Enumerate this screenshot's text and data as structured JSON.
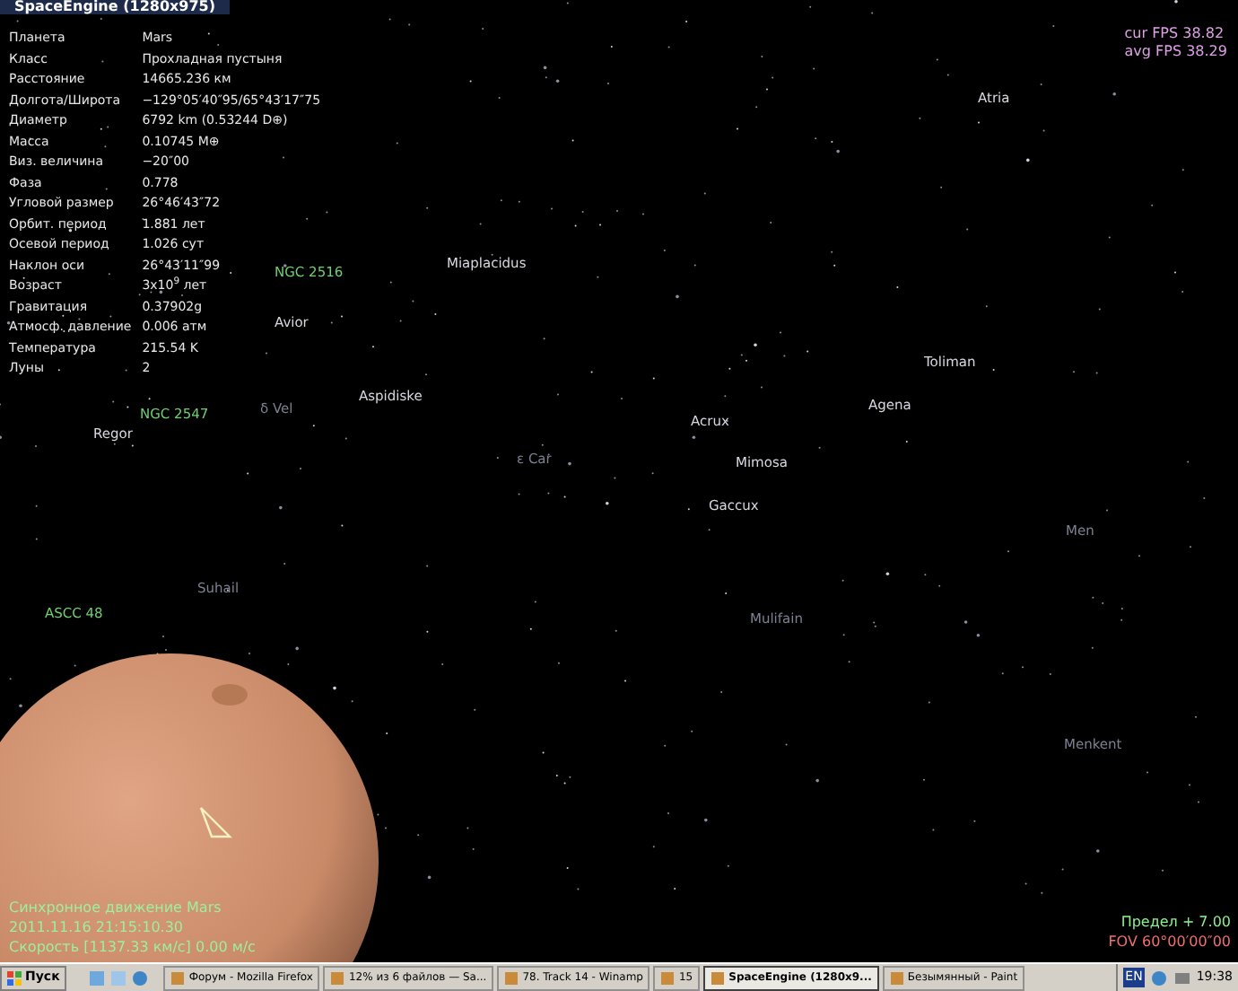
{
  "window": {
    "title": "SpaceEngine (1280x975)"
  },
  "info": [
    {
      "label": "Планета",
      "value": "Mars"
    },
    {
      "label": "Класс",
      "value": "Прохладная пустыня"
    },
    {
      "label": "Расстояние",
      "value": "14665.236 км"
    },
    {
      "label": "Долгота/Широта",
      "value": "−129°05′40″95/65°43′17″75"
    },
    {
      "label": "Диаметр",
      "value": "6792 km (0.53244 D⊕)"
    },
    {
      "label": "Масса",
      "value": "0.10745 M⊕"
    },
    {
      "label": "Виз. величина",
      "value": "−20″00"
    },
    {
      "label": "Фаза",
      "value": "0.778"
    },
    {
      "label": "Угловой размер",
      "value": "26°46′43″72"
    },
    {
      "label": "Орбит. период",
      "value": "1.881 лет"
    },
    {
      "label": "Осевой период",
      "value": "1.026 сут"
    },
    {
      "label": "Наклон оси",
      "value": "26°43′11″99"
    },
    {
      "label": "Возраст",
      "value": "3x10$^{9}$ лет"
    },
    {
      "label": "Гравитация",
      "value": "0.37902g"
    },
    {
      "label": "Атмосф. давление",
      "value": "0.006 атм"
    },
    {
      "label": "Температура",
      "value": "215.54 K"
    },
    {
      "label": "Луны",
      "value": "2"
    }
  ],
  "fps": [
    "cur FPS 38.82",
    "avg FPS 38.29"
  ],
  "sky_labels": [
    {
      "text": "Atria",
      "kind": "star"
    },
    {
      "text": "Miaplacidus",
      "kind": "star"
    },
    {
      "text": "NGC 2516",
      "kind": "cluster"
    },
    {
      "text": "Avior",
      "kind": "star"
    },
    {
      "text": "Aspidiske",
      "kind": "star"
    },
    {
      "text": "NGC 2547",
      "kind": "cluster"
    },
    {
      "text": "Regor",
      "kind": "star"
    },
    {
      "text": "δ Vel",
      "kind": "faint"
    },
    {
      "text": "Toliman",
      "kind": "star"
    },
    {
      "text": "Agena",
      "kind": "star"
    },
    {
      "text": "Acrux",
      "kind": "star"
    },
    {
      "text": "ε Car",
      "kind": "faint"
    },
    {
      "text": "Mimosa",
      "kind": "star"
    },
    {
      "text": "Gaccux",
      "kind": "star"
    },
    {
      "text": "Men",
      "kind": "faint"
    },
    {
      "text": "Suhail",
      "kind": "faint"
    },
    {
      "text": "ASCC 48",
      "kind": "cluster"
    },
    {
      "text": "Mulifain",
      "kind": "faint"
    },
    {
      "text": "Menkent",
      "kind": "faint"
    }
  ],
  "status_lines": [
    "Синхронное движение Mars",
    "2011.11.16  21:15:10.30",
    "Скорость [1137.33 км/с] 0.00 м/с"
  ],
  "limit": "Предел +  7.00",
  "fov": "FOV  60°00′00″00",
  "taskbar": {
    "start": "Пуск",
    "tasks": [
      {
        "label": "Форум - Mozilla Firefox",
        "selected": false
      },
      {
        "label": "12% из 6 файлов — Sa...",
        "selected": false
      },
      {
        "label": "78. Track 14 - Winamp",
        "selected": false
      },
      {
        "label": "15",
        "selected": false
      },
      {
        "label": "SpaceEngine (1280x9...",
        "selected": true
      },
      {
        "label": "Безымянный - Paint",
        "selected": false
      }
    ],
    "language": "EN",
    "clock": "19:38"
  }
}
